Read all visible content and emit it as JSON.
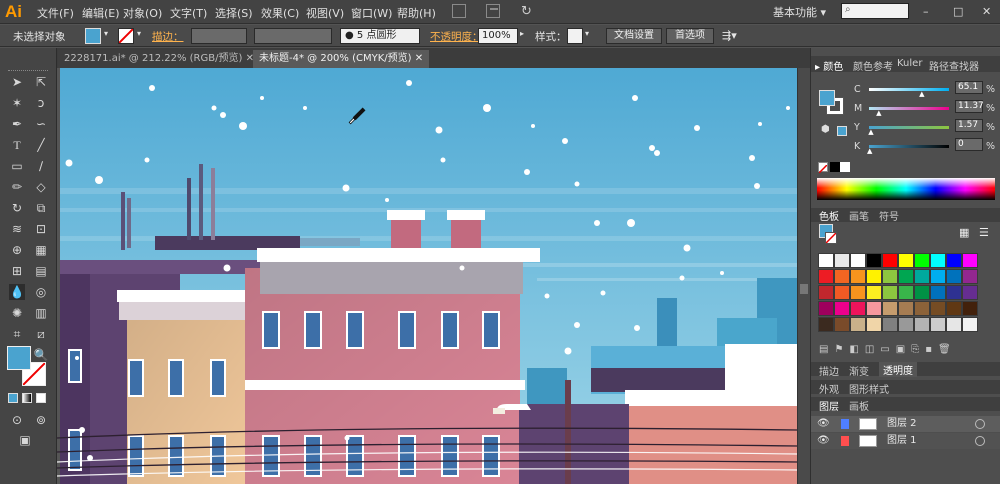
{
  "app": {
    "logo": "Ai",
    "menus": [
      "文件(F)",
      "编辑(E)",
      "对象(O)",
      "文字(T)",
      "选择(S)",
      "效果(C)",
      "视图(V)",
      "窗口(W)",
      "帮助(H)"
    ],
    "workspace": "基本功能",
    "workspace_arrow": "▾",
    "search_icon": "⌕",
    "min": "–",
    "max": "□",
    "close": "✕"
  },
  "control": {
    "selection": "未选择对象",
    "stroke_label": "描边：",
    "brush": "5 点圆形",
    "opacity_label": "不透明度：",
    "opacity_value": "100%",
    "style_label": "样式：",
    "doc_setup": "文档设置",
    "prefs": "首选项"
  },
  "tabs": [
    {
      "label": "2228171.ai* @ 212.22% (RGB/预览)",
      "close": "✕"
    },
    {
      "label": "未标题-4* @ 200% (CMYK/预览)",
      "close": "✕"
    }
  ],
  "color_panel": {
    "tabs": [
      "颜色",
      "颜色参考",
      "Kuler",
      "路径查找器"
    ],
    "labels": [
      "C",
      "M",
      "Y",
      "K"
    ],
    "values": [
      "65.1",
      "11.37",
      "1.57",
      "0"
    ],
    "units": [
      "%",
      "%",
      "%",
      "%"
    ],
    "fractions": [
      0.651,
      0.1137,
      0.0157,
      0
    ],
    "fill_color": "#4aa3cf"
  },
  "second_panel": {
    "tabs": [
      "描边",
      "画笔",
      "符号"
    ]
  },
  "swatches_panel": {
    "tabs": [
      "色板",
      "渐变",
      "透明度"
    ],
    "colors": [
      "#ffffff",
      "#e9e9e9",
      "#ffffff",
      "#000000",
      "#ff0000",
      "#ffff00",
      "#00ff00",
      "#00ffff",
      "#0000ff",
      "#ff00ff",
      "#ed1c24",
      "#f26522",
      "#f7941d",
      "#fff200",
      "#8dc63f",
      "#00a651",
      "#00a99d",
      "#00aeef",
      "#0072bc",
      "#92278f",
      "#c1272d",
      "#f15a24",
      "#f7931e",
      "#fcee21",
      "#8cc63f",
      "#39b54a",
      "#009245",
      "#0071bc",
      "#2e3192",
      "#662d91",
      "#9e005d",
      "#ec008c",
      "#ed145b",
      "#f6989d",
      "#c69c6d",
      "#a67c52",
      "#8c6239",
      "#754c24",
      "#603813",
      "#42210b",
      "#3b2a1f",
      "#7a4b2a",
      "#c9b18a",
      "#f0d5a8",
      "#808080",
      "#999999",
      "#b3b3b3",
      "#cccccc",
      "#e6e6e6",
      "#f2f2f2"
    ]
  },
  "bottom_panel": {
    "tabs": [
      "外观",
      "图形样式"
    ]
  },
  "layers_panel": {
    "tabs": [
      "图层",
      "画板"
    ],
    "layers": [
      {
        "name": "图层 2",
        "color": "#4f7fff"
      },
      {
        "name": "图层 1",
        "color": "#ff4f4f"
      }
    ]
  }
}
